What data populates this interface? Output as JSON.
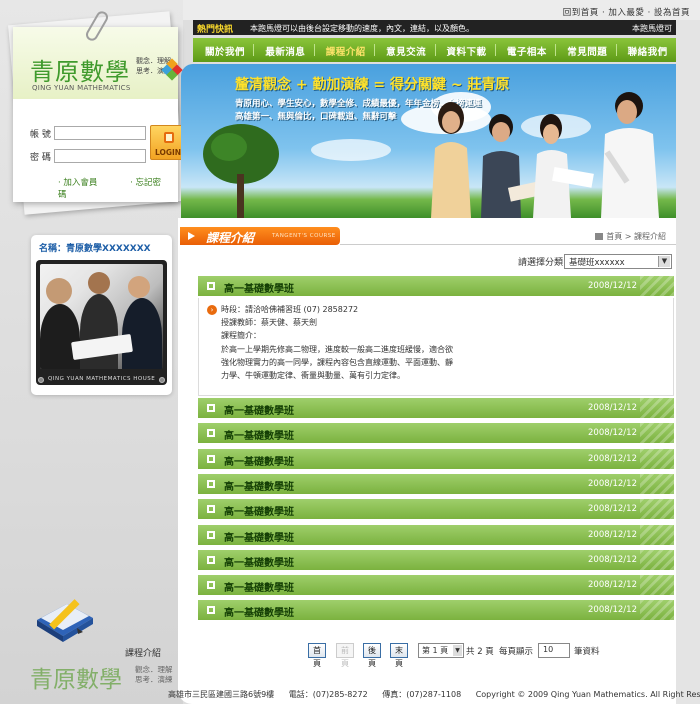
{
  "top_links": {
    "home": "回到首頁",
    "favorite": "加入最愛",
    "set_home": "設為首頁"
  },
  "news": {
    "label": "熱門快訊",
    "ticker": "本跑馬燈可以由後台設定移動的速度，內文，連結，以及顏色。",
    "right": "本跑馬燈可"
  },
  "logo": {
    "title": "青原數學",
    "side_line1": "觀念．理解",
    "side_line2": "思考．演練",
    "english": "QING YUAN MATHEMATICS"
  },
  "login": {
    "account_label": "帳 號",
    "password_label": "密 碼",
    "button": "LOGIN",
    "join": "加入會員",
    "forgot": "忘記密碼"
  },
  "nav": [
    "關於我們",
    "最新消息",
    "課程介紹",
    "意見交流",
    "資料下載",
    "電子相本",
    "常見問題",
    "聯絡我們"
  ],
  "nav_active_index": 2,
  "banner": {
    "title": "釐清觀念 + 勤加演練 = 得分關鍵 ~ 莊青原",
    "line1": "青原用心、學生安心，數學全修、成績最優，年年金榜、金榜連連",
    "line2": "高雄第一、無與倫比，口碑載道、無辭可擊"
  },
  "profile": {
    "name": "名稱：青原數學XXXXXXX",
    "caption": "QING YUAN MATHEMATICS HOUSE"
  },
  "section": {
    "title": "課程介紹",
    "english": "TANGENT'S COURSE"
  },
  "breadcrumb": "首頁 > 課程介紹",
  "filter": {
    "label": "請選擇分類",
    "selected": "基礎班xxxxxx"
  },
  "rows": [
    {
      "title": "高一基礎數學班",
      "date": "2008/12/12"
    },
    {
      "title": "高一基礎數學班",
      "date": "2008/12/12"
    },
    {
      "title": "高一基礎數學班",
      "date": "2008/12/12"
    },
    {
      "title": "高一基礎數學班",
      "date": "2008/12/12"
    },
    {
      "title": "高一基礎數學班",
      "date": "2008/12/12"
    },
    {
      "title": "高一基礎數學班",
      "date": "2008/12/12"
    },
    {
      "title": "高一基礎數學班",
      "date": "2008/12/12"
    },
    {
      "title": "高一基礎數學班",
      "date": "2008/12/12"
    },
    {
      "title": "高一基礎數學班",
      "date": "2008/12/12"
    },
    {
      "title": "高一基礎數學班",
      "date": "2008/12/12"
    }
  ],
  "detail": {
    "time": "時段：請洽哈佛補習班 (07) 2858272",
    "teacher": "授課教師：蔡天健、蔡天劍",
    "intro_label": "課程簡介：",
    "intro_1": "於高一上學期先修高二物理，進度較一般高二進度班緩慢，適合欲",
    "intro_2": "強化物理實力的高一同學，課程內容包含直線運動、平面運動、靜",
    "intro_3": "力學、牛頓運動定律、衝量與動量、萬有引力定律。"
  },
  "pager": {
    "first": "首頁",
    "prev": "前頁",
    "next": "後頁",
    "last": "末頁",
    "page_select": "第 1 頁",
    "total": "共 2 頁",
    "per_page_label": "每頁顯示",
    "per_page_value": "10",
    "per_page_unit": "筆資料"
  },
  "sidebar_bottom": {
    "label": "課程介紹",
    "logo": "青原數學",
    "sub1": "觀念．理解",
    "sub2": "思考．演練"
  },
  "footer": {
    "address": "高雄市三民區建國三路6號9樓",
    "phone": "電話：(07)285-8272",
    "fax": "傳真：(07)287-1108",
    "copyright": "Copyright © 2009 Qing Yuan Mathematics. All Right Reserved."
  },
  "colors": {
    "green": "#7bb23f",
    "orange": "#e95e06",
    "yellow": "#fde36a",
    "blue": "#1d5ea7"
  }
}
